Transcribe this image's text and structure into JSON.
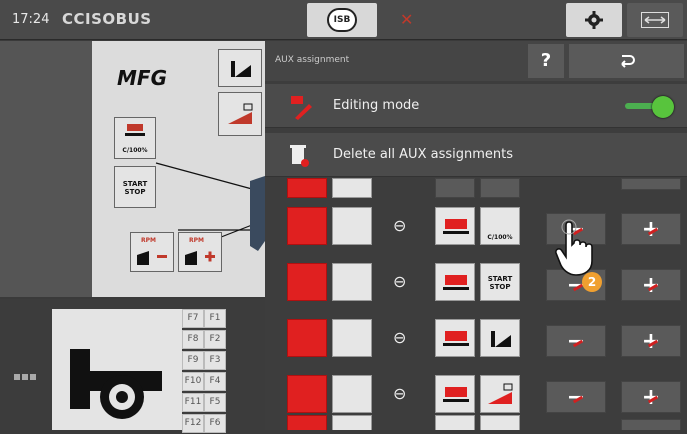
{
  "header": {
    "time": "17:24",
    "brand": "CCISOBUS",
    "isb_label": "ISB"
  },
  "machine": {
    "title": "MFG",
    "softkey_c100": "C/100%",
    "softkey_start_stop": "START STOP",
    "rpm_minus": "RPM",
    "rpm_plus": "RPM"
  },
  "function_keys": [
    [
      "F7",
      "F1"
    ],
    [
      "F8",
      "F2"
    ],
    [
      "F9",
      "F3"
    ],
    [
      "F10",
      "F4"
    ],
    [
      "F11",
      "F5"
    ],
    [
      "F12",
      "F6"
    ]
  ],
  "aux_panel": {
    "title": "AUX assignment",
    "help_label": "?",
    "editing_mode_label": "Editing mode",
    "editing_mode_on": true,
    "delete_label": "Delete all AUX assignments",
    "rows": [
      {
        "function_label": "C/100%"
      },
      {
        "function_label": "START STOP"
      },
      {
        "function_label": ""
      },
      {
        "function_label": ""
      },
      {
        "function_label": ""
      }
    ],
    "step_badge": "2"
  },
  "colors": {
    "accent_red": "#e02020",
    "toggle_green": "#58c43d",
    "badge_orange": "#f0a030"
  }
}
